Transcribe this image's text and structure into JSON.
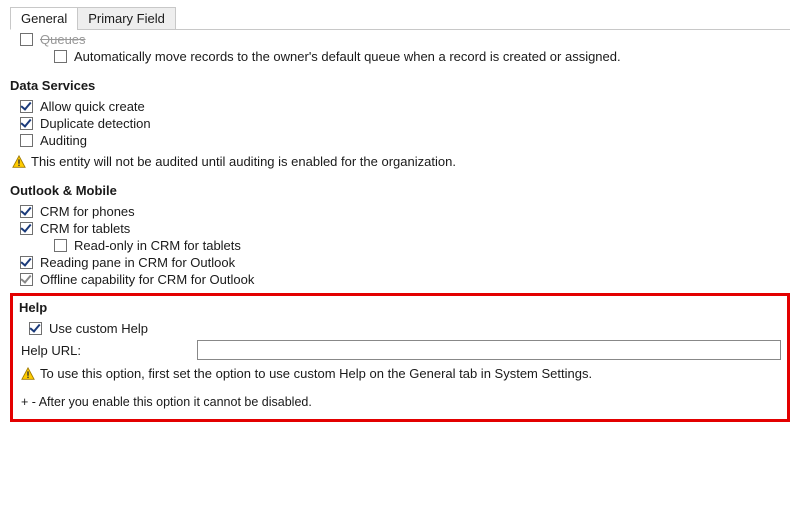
{
  "tabs": {
    "general": "General",
    "primary_field": "Primary Field"
  },
  "queues_label": "Queues",
  "auto_move_label": "Automatically move records to the owner's default queue when a record is created or assigned.",
  "data_services": {
    "title": "Data Services",
    "quick_create": "Allow quick create",
    "dup_detect": "Duplicate detection",
    "auditing": "Auditing",
    "audit_note": "This entity will not be audited until auditing is enabled for the organization."
  },
  "outlook": {
    "title": "Outlook & Mobile",
    "phones": "CRM for phones",
    "tablets": "CRM for tablets",
    "readonly_tablets": "Read-only in CRM for tablets",
    "reading_pane": "Reading pane in CRM for Outlook",
    "offline": "Offline capability for CRM for Outlook"
  },
  "help": {
    "title": "Help",
    "use_custom": "Use custom Help",
    "url_label": "Help URL:",
    "url_value": "",
    "note": "To use this option, first set the option to use custom Help on the General tab in System Settings.",
    "footnote": "+ - After you enable this option it cannot be disabled."
  }
}
